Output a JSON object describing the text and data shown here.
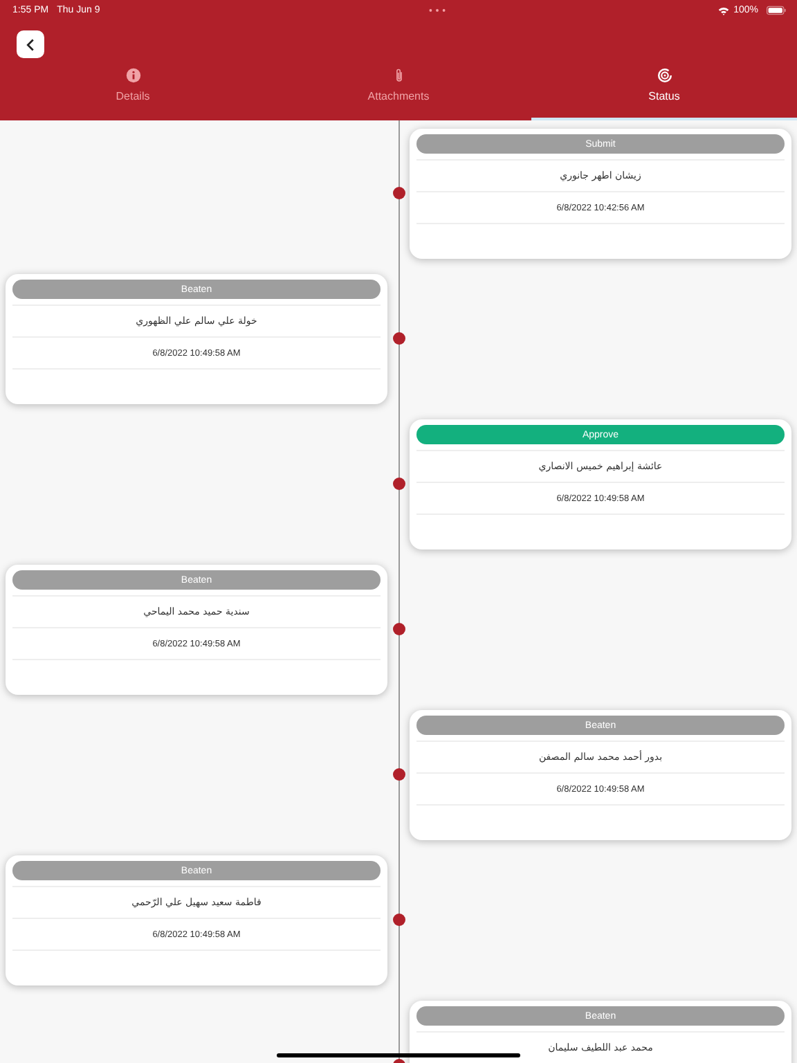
{
  "status_bar": {
    "time": "1:55 PM",
    "date": "Thu Jun 9",
    "battery": "100%"
  },
  "tabs": [
    {
      "label": "Details",
      "selected": false
    },
    {
      "label": "Attachments",
      "selected": false
    },
    {
      "label": "Status",
      "selected": true
    }
  ],
  "timeline": [
    {
      "status": {
        "label": "Submit",
        "color": "#9e9e9e"
      },
      "name": "زيشان اطهر جانوري",
      "time": "6/8/2022 10:42:56 AM"
    },
    {
      "status": {
        "label": "Beaten",
        "color": "#9e9e9e"
      },
      "name": "خولة علي سالم علي الظهوري",
      "time": "6/8/2022 10:49:58 AM"
    },
    {
      "status": {
        "label": "Approve",
        "color": "#13b07e"
      },
      "name": "عائشة إبراهيم خميس الانصاري",
      "time": "6/8/2022 10:49:58 AM"
    },
    {
      "status": {
        "label": "Beaten",
        "color": "#9e9e9e"
      },
      "name": "سندية حميد محمد اليماحي",
      "time": "6/8/2022 10:49:58 AM"
    },
    {
      "status": {
        "label": "Beaten",
        "color": "#9e9e9e"
      },
      "name": "بدور أحمد محمد سالم المصفن",
      "time": "6/8/2022 10:49:58 AM"
    },
    {
      "status": {
        "label": "Beaten",
        "color": "#9e9e9e"
      },
      "name": "فاطمة سعيد سهيل علي الرّحمي",
      "time": "6/8/2022 10:49:58 AM"
    },
    {
      "status": {
        "label": "Beaten",
        "color": "#9e9e9e"
      },
      "name": "محمد عبد اللطيف سليمان"
    }
  ]
}
